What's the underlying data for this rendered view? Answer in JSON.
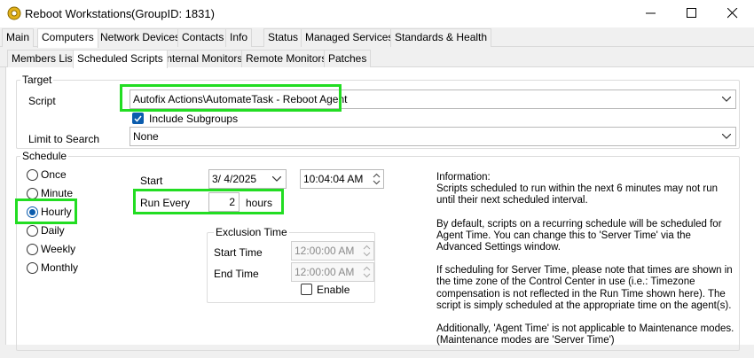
{
  "window": {
    "title": "Reboot Workstations",
    "group": "(GroupID: 1831)",
    "icon": "gear-icon"
  },
  "main_tabs": [
    {
      "label": "Main"
    },
    {
      "label": "Computers"
    },
    {
      "label": "Network Devices"
    },
    {
      "label": "Contacts"
    },
    {
      "label": "Info"
    },
    {
      "label": "Status"
    },
    {
      "label": "Managed Services"
    },
    {
      "label": "Standards & Health"
    }
  ],
  "sub_tabs": [
    {
      "label": "Members List"
    },
    {
      "label": "Scheduled Scripts"
    },
    {
      "label": "Internal Monitors"
    },
    {
      "label": "Remote Monitors"
    },
    {
      "label": "Patches"
    }
  ],
  "target": {
    "legend": "Target",
    "script_label": "Script",
    "script_value": "Autofix Actions\\AutomateTask - Reboot Agent",
    "include_subgroups_label": "Include Subgroups",
    "include_subgroups_checked": true,
    "limit_label": "Limit to Search",
    "limit_value": "None"
  },
  "schedule": {
    "legend": "Schedule",
    "options": [
      {
        "label": "Once",
        "checked": false
      },
      {
        "label": "Minute",
        "checked": false
      },
      {
        "label": "Hourly",
        "checked": true
      },
      {
        "label": "Daily",
        "checked": false
      },
      {
        "label": "Weekly",
        "checked": false
      },
      {
        "label": "Monthly",
        "checked": false
      }
    ],
    "start_label": "Start",
    "start_date": "3/  4/2025",
    "start_time": "10:04:04 AM",
    "run_every_label": "Run Every",
    "run_every_value": "2",
    "run_every_unit": "hours",
    "exclusion": {
      "legend": "Exclusion Time",
      "start_label": "Start Time",
      "start_value": "12:00:00 AM",
      "end_label": "End Time",
      "end_value": "12:00:00 AM",
      "enable_label": "Enable",
      "enable_checked": false
    },
    "info": [
      "Information:\nScripts scheduled to run within the next 6 minutes may not run until their next scheduled interval.",
      "By default, scripts on a recurring schedule will be scheduled for Agent Time. You can change this to 'Server Time' via the Advanced Settings window.",
      "If scheduling for Server Time, please note that times are shown in the time zone of the Control Center in use (i.e.: Timezone compensation is not reflected in the Run Time shown here). The script is simply scheduled at the appropriate time on the agent(s).",
      "Additionally, 'Agent Time' is not applicable to Maintenance modes. (Maintenance modes are 'Server Time')"
    ]
  },
  "colors": {
    "highlight": "#22dd22",
    "accent": "#0b5cad"
  }
}
